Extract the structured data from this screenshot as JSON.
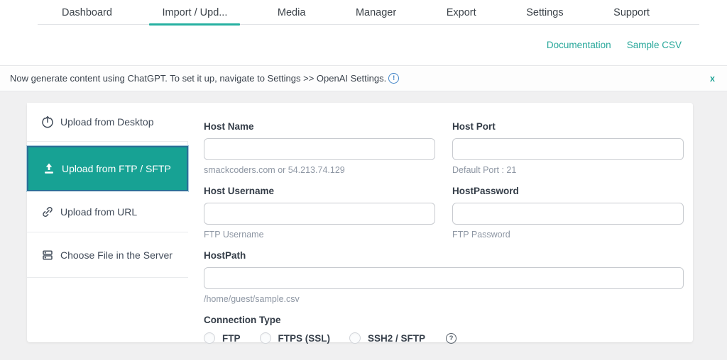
{
  "tabs": {
    "items": [
      {
        "label": "Dashboard"
      },
      {
        "label": "Import / Upd...",
        "active": true
      },
      {
        "label": "Media"
      },
      {
        "label": "Manager"
      },
      {
        "label": "Export"
      },
      {
        "label": "Settings"
      },
      {
        "label": "Support"
      }
    ]
  },
  "header_links": {
    "documentation": "Documentation",
    "sample_csv": "Sample CSV"
  },
  "notice": {
    "message": "Now generate content using ChatGPT. To set it up, navigate to Settings >> OpenAI Settings.",
    "info_glyph": "!",
    "close_glyph": "x"
  },
  "sidebar": {
    "items": [
      {
        "label": "Upload from Desktop",
        "icon": "cloud-upload-icon",
        "selected": false
      },
      {
        "label": "Upload from FTP / SFTP",
        "icon": "upload-tray-icon",
        "selected": true
      },
      {
        "label": "Upload from URL",
        "icon": "link-icon",
        "selected": false
      },
      {
        "label": "Choose File in the Server",
        "icon": "server-icon",
        "selected": false
      }
    ]
  },
  "form": {
    "host_name": {
      "label": "Host Name",
      "value": "",
      "hint": "smackcoders.com or 54.213.74.129"
    },
    "host_port": {
      "label": "Host Port",
      "value": "",
      "hint": "Default Port : 21"
    },
    "host_username": {
      "label": "Host Username",
      "value": "",
      "hint": "FTP Username"
    },
    "host_password": {
      "label": "HostPassword",
      "value": "",
      "hint": "FTP Password"
    },
    "host_path": {
      "label": "HostPath",
      "value": "",
      "hint": "/home/guest/sample.csv"
    },
    "connection_type": {
      "label": "Connection Type",
      "help_glyph": "?",
      "options": [
        {
          "label": "FTP",
          "checked": false
        },
        {
          "label": "FTPS (SSL)",
          "checked": false
        },
        {
          "label": "SSH2 / SFTP",
          "checked": false
        }
      ]
    }
  },
  "colors": {
    "accent_teal": "#17a294",
    "link_teal": "#27a79a",
    "selected_border_blue": "#2d6f97",
    "info_blue": "#4285c8",
    "page_background": "#f0f0f1",
    "label_text": "#333c47",
    "hint_text": "#8d96a3"
  }
}
